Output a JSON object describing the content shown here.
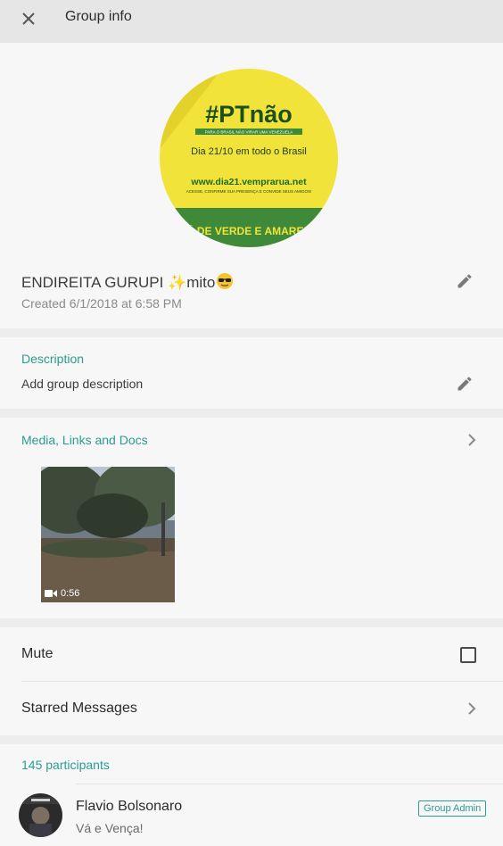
{
  "header": {
    "title": "Group info",
    "close_icon": "close-icon"
  },
  "profile": {
    "name_text": "ENDIREITA GURUPI ",
    "name_suffix": "mito",
    "created": "Created 6/1/2018 at 6:58 PM",
    "photo": {
      "headline": "#PTnão",
      "banner": "PARA O BRASIL NÃO VIRAR UMA VENEZUELA",
      "date_line": "Dia 21/10 em todo o Brasil",
      "url": "www.dia21.vemprarua.net",
      "small": "ACESSE, CONFIRME SUA PRESENÇA E CONVIDE SEUS AMIGOS!",
      "bottom": "VÁ DE VERDE E AMARELO"
    }
  },
  "description": {
    "title": "Description",
    "placeholder": "Add group description"
  },
  "media": {
    "title": "Media, Links and Docs",
    "duration": "0:56"
  },
  "settings": {
    "mute": "Mute",
    "starred": "Starred Messages"
  },
  "participants": {
    "count": "145 participants",
    "items": [
      {
        "name": "Flavio Bolsonaro",
        "status": "Vá e Vença!",
        "badge": "Group Admin"
      }
    ]
  },
  "colors": {
    "accent": "#2a9d8f",
    "poster_yellow": "#f2e33a",
    "poster_green": "#3f8a3a"
  }
}
